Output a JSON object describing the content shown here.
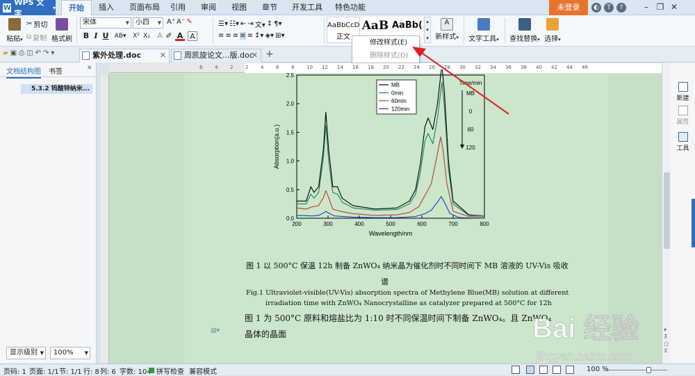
{
  "app": {
    "title": "WPS 文字",
    "login": "未登录"
  },
  "menu": {
    "tabs": [
      "开始",
      "插入",
      "页面布局",
      "引用",
      "审阅",
      "视图",
      "章节",
      "开发工具",
      "特色功能"
    ],
    "active": "开始"
  },
  "ribbon": {
    "paste": "粘贴",
    "cut": "剪切",
    "copy": "复制",
    "format_painter": "格式刷",
    "font_name": "宋体",
    "font_size": "小四",
    "styles": [
      {
        "sample": "AaBbCcD",
        "name": "正文"
      },
      {
        "sample": "AaB",
        "name": ""
      },
      {
        "sample": "AaBb(",
        "name": ""
      }
    ],
    "new_style": "新样式",
    "text_tools": "文字工具",
    "find_replace": "查找替换",
    "select": "选择"
  },
  "style_menu": {
    "items": [
      "修改样式(E)",
      "删除样式(D)"
    ]
  },
  "doc_tabs": [
    "紫外处理.doc",
    "周凯旋论文...版.doc"
  ],
  "nav": {
    "tabs": [
      "文档结构图",
      "书签"
    ],
    "item": "5.3.2 钨酸锌纳米...",
    "level_select": "显示级别",
    "zoom_select": "100%"
  },
  "ruler": {
    "ticks": [
      "6",
      "4",
      "2",
      "2",
      "4",
      "6",
      "8",
      "10",
      "12",
      "14",
      "16",
      "18",
      "20",
      "22",
      "24",
      "26",
      "28",
      "30",
      "32",
      "34",
      "36",
      "38",
      "40",
      "42",
      "44",
      "46"
    ]
  },
  "document": {
    "caption_cn_line1": "图 1 以 500°C 保温 12h 制备 ZnWO₄ 纳米晶为催化剂时不同时间下 MB 溶液的 UV-Vis 吸收",
    "caption_cn_line2": "谱",
    "caption_en_line1": "Fig.1 Ultraviolet-visible(UV-Vis) absorption spectra of Methylene Blue(MB) solution at different",
    "caption_en_line2": "irradiation time with ZnWO₄ Nanocrystalline as catalyzer prepared at 500°C for 12h",
    "body_line1": "图 1 为 500°C 原料和熔盐比为 1:10 时不同保温时间下制备 ZnWO₄。且 ZnWO₄",
    "body_line2": "晶体的晶面"
  },
  "task_pane": {
    "new": "新建",
    "properties": "属性",
    "tools": "工具"
  },
  "status": {
    "page_no": "页码: 1",
    "pages": "页面: 1/1",
    "section": "节: 1/1",
    "row": "行: 8",
    "col": "列: 6",
    "word_count": "字数: 104",
    "spell": "拼写检查",
    "compat": "兼容模式",
    "zoom": "100 %"
  },
  "watermark": {
    "brand": "Bai 经验",
    "url": "jingyan.baidu.com"
  },
  "chart_data": {
    "type": "line",
    "xlabel": "Wavelength/nm",
    "ylabel": "Absorption(a.u.)",
    "xlim": [
      200,
      800
    ],
    "ylim": [
      0.0,
      2.5
    ],
    "x_ticks": [
      200,
      300,
      400,
      500,
      600,
      700,
      800
    ],
    "y_ticks": [
      0.0,
      0.5,
      1.0,
      1.5,
      2.0,
      2.5
    ],
    "legend": [
      "MB",
      "0min",
      "60min",
      "120min"
    ],
    "legend_position": "top-center",
    "annotation": {
      "title": "Time/min",
      "labels": [
        "MB",
        "0",
        "60",
        "120"
      ]
    },
    "series": [
      {
        "name": "MB",
        "color": "#000000",
        "x": [
          200,
          230,
          245,
          255,
          270,
          285,
          293,
          302,
          315,
          330,
          345,
          380,
          450,
          520,
          560,
          580,
          595,
          610,
          620,
          635,
          650,
          664,
          672,
          685,
          700,
          750,
          800
        ],
        "y": [
          0.3,
          0.3,
          0.55,
          0.45,
          0.55,
          1.2,
          1.85,
          1.2,
          0.55,
          0.55,
          0.35,
          0.22,
          0.16,
          0.18,
          0.3,
          0.5,
          0.95,
          1.6,
          1.75,
          1.55,
          2.0,
          2.68,
          2.2,
          1.0,
          0.3,
          0.06,
          0.04
        ]
      },
      {
        "name": "0min",
        "color": "#1b7f5e",
        "x": [
          200,
          230,
          245,
          255,
          270,
          285,
          293,
          302,
          315,
          330,
          345,
          380,
          450,
          520,
          560,
          580,
          595,
          610,
          620,
          635,
          650,
          664,
          672,
          685,
          700,
          750,
          800
        ],
        "y": [
          0.25,
          0.25,
          0.42,
          0.35,
          0.45,
          1.05,
          1.62,
          1.0,
          0.45,
          0.42,
          0.28,
          0.18,
          0.14,
          0.15,
          0.25,
          0.42,
          0.8,
          1.35,
          1.48,
          1.3,
          1.75,
          2.38,
          1.95,
          0.85,
          0.25,
          0.05,
          0.04
        ]
      },
      {
        "name": "60min",
        "color": "#c0392b",
        "x": [
          200,
          230,
          250,
          270,
          285,
          293,
          302,
          315,
          340,
          380,
          450,
          520,
          560,
          590,
          610,
          630,
          645,
          660,
          668,
          680,
          700,
          750,
          800
        ],
        "y": [
          0.18,
          0.16,
          0.2,
          0.22,
          0.36,
          0.48,
          0.36,
          0.16,
          0.12,
          0.08,
          0.05,
          0.06,
          0.1,
          0.2,
          0.4,
          0.6,
          1.0,
          1.42,
          1.18,
          0.6,
          0.12,
          0.03,
          0.02
        ]
      },
      {
        "name": "120min",
        "color": "#1f3fb5",
        "x": [
          200,
          250,
          270,
          285,
          293,
          302,
          320,
          380,
          450,
          520,
          580,
          610,
          630,
          650,
          662,
          672,
          690,
          720,
          800
        ],
        "y": [
          0.05,
          0.04,
          0.05,
          0.09,
          0.12,
          0.09,
          0.04,
          0.02,
          0.01,
          0.01,
          0.03,
          0.08,
          0.14,
          0.28,
          0.38,
          0.28,
          0.08,
          0.01,
          0.0
        ]
      }
    ]
  }
}
